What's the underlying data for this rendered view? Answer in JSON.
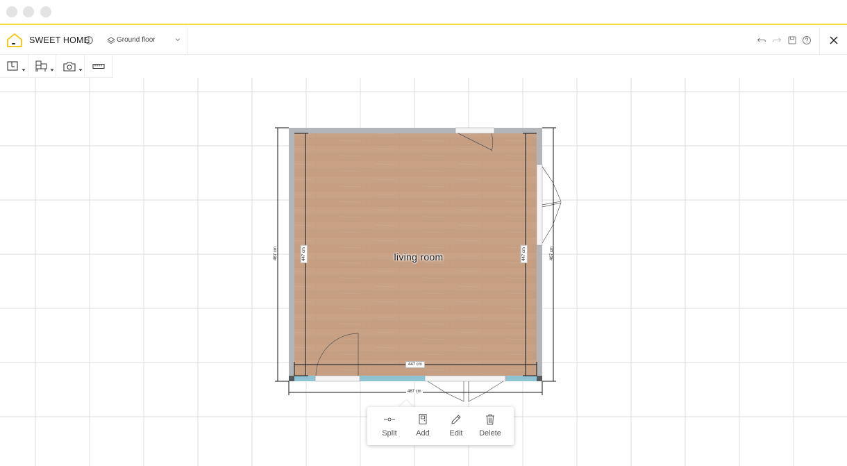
{
  "window": {
    "traffic_lights": [
      "close",
      "minimize",
      "zoom"
    ]
  },
  "app": {
    "title": "SWEET HOME",
    "accent_color": "#f2dc3b",
    "floor_selector": {
      "value": "Ground floor"
    },
    "actions": [
      "undo-icon",
      "redo-icon",
      "save-icon",
      "help-icon",
      "close-icon"
    ]
  },
  "toolbar": {
    "tools": [
      "floor-plan-icon",
      "furniture-icon",
      "camera-icon",
      "ruler-icon"
    ]
  },
  "plan": {
    "room_name": "living room",
    "dimensions": {
      "outer_left": "467 cm",
      "inner_left": "447 cm",
      "inner_right": "447 cm",
      "outer_right": "467 cm",
      "inner_bottom": "447 cm",
      "outer_bottom": "467 cm"
    },
    "colors": {
      "floor": "#c9a286",
      "wall": "#b3b6b9",
      "window": "#8ec3d3",
      "grid": "#dcdcdc"
    }
  },
  "wall_popup": {
    "buttons": [
      {
        "label": "Split",
        "icon": "split-icon"
      },
      {
        "label": "Add",
        "icon": "door-icon"
      },
      {
        "label": "Edit",
        "icon": "pencil-icon"
      },
      {
        "label": "Delete",
        "icon": "trash-icon"
      }
    ]
  }
}
